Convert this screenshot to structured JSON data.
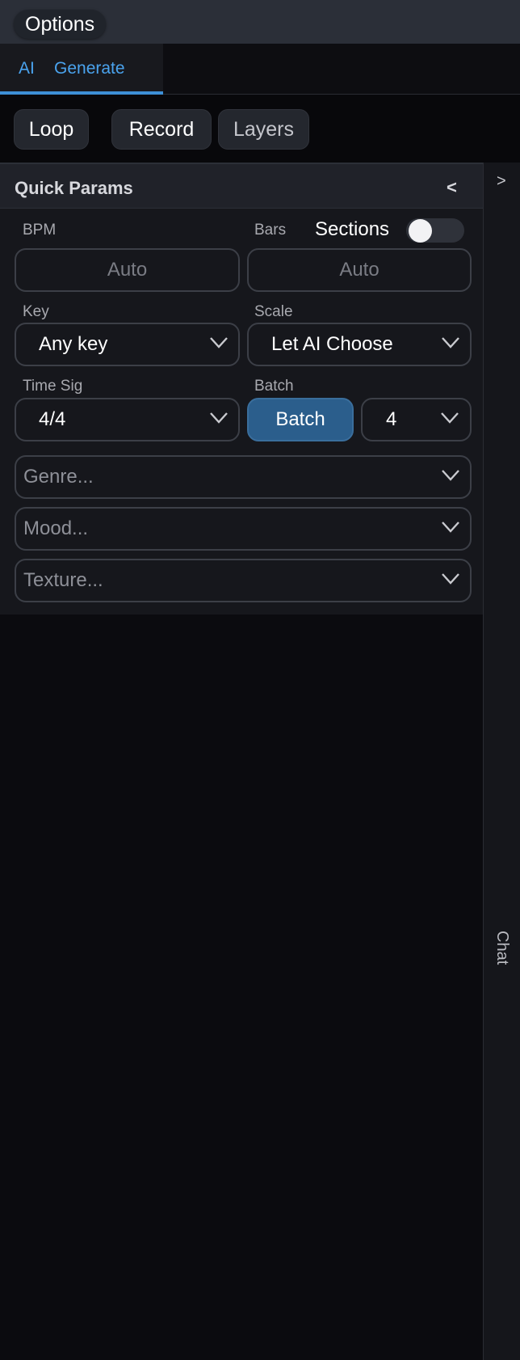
{
  "topbar": {
    "options_label": "Options"
  },
  "tabs": [
    {
      "label": "AI",
      "active": true
    },
    {
      "label": "Generate",
      "active": true
    }
  ],
  "modes": {
    "loop": "Loop",
    "record": "Record",
    "layers": "Layers"
  },
  "quick_params": {
    "title": "Quick Params",
    "collapse_glyph": "<",
    "bpm": {
      "label": "BPM",
      "placeholder": "Auto"
    },
    "bars": {
      "label": "Bars",
      "placeholder": "Auto"
    },
    "sections": {
      "label": "Sections",
      "enabled": false
    },
    "key": {
      "label": "Key",
      "value": "Any key"
    },
    "scale": {
      "label": "Scale",
      "value": "Let AI Choose"
    },
    "time_sig": {
      "label": "Time Sig",
      "value": "4/4"
    },
    "batch": {
      "label": "Batch",
      "button": "Batch",
      "count": "4"
    },
    "genre": {
      "placeholder": "Genre..."
    },
    "mood": {
      "placeholder": "Mood..."
    },
    "texture": {
      "placeholder": "Texture..."
    }
  },
  "chat": {
    "expand_glyph": ">",
    "label": "Chat"
  },
  "colors": {
    "accent": "#3d8fd6",
    "batch_button": "#2b5e8c",
    "background": "#0b0b0f",
    "panel": "#16171c"
  },
  "icons": {
    "dropdown": "chevron-down-icon",
    "collapse": "chevron-left-icon",
    "expand": "chevron-right-icon"
  }
}
